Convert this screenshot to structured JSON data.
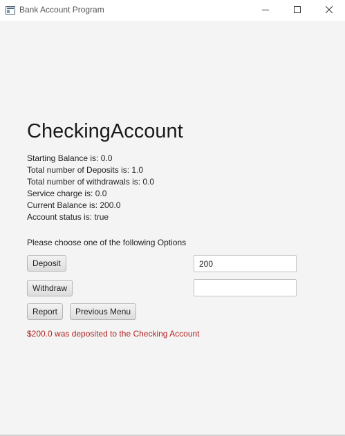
{
  "window": {
    "title": "Bank Account Program"
  },
  "account": {
    "heading": "CheckingAccount",
    "lines": [
      "Starting Balance is: 0.0",
      "Total number of Deposits is: 1.0",
      "Total number of withdrawals is: 0.0",
      "Service charge is: 0.0",
      "Current Balance is: 200.0",
      "Account status is: true"
    ]
  },
  "options": {
    "prompt": "Please choose one of the following Options",
    "deposit_label": "Deposit",
    "withdraw_label": "Withdraw",
    "report_label": "Report",
    "previous_menu_label": "Previous Menu",
    "deposit_value": "200",
    "withdraw_value": ""
  },
  "status": {
    "message": "$200.0 was deposited to the Checking Account",
    "message_color": "#b22222"
  }
}
